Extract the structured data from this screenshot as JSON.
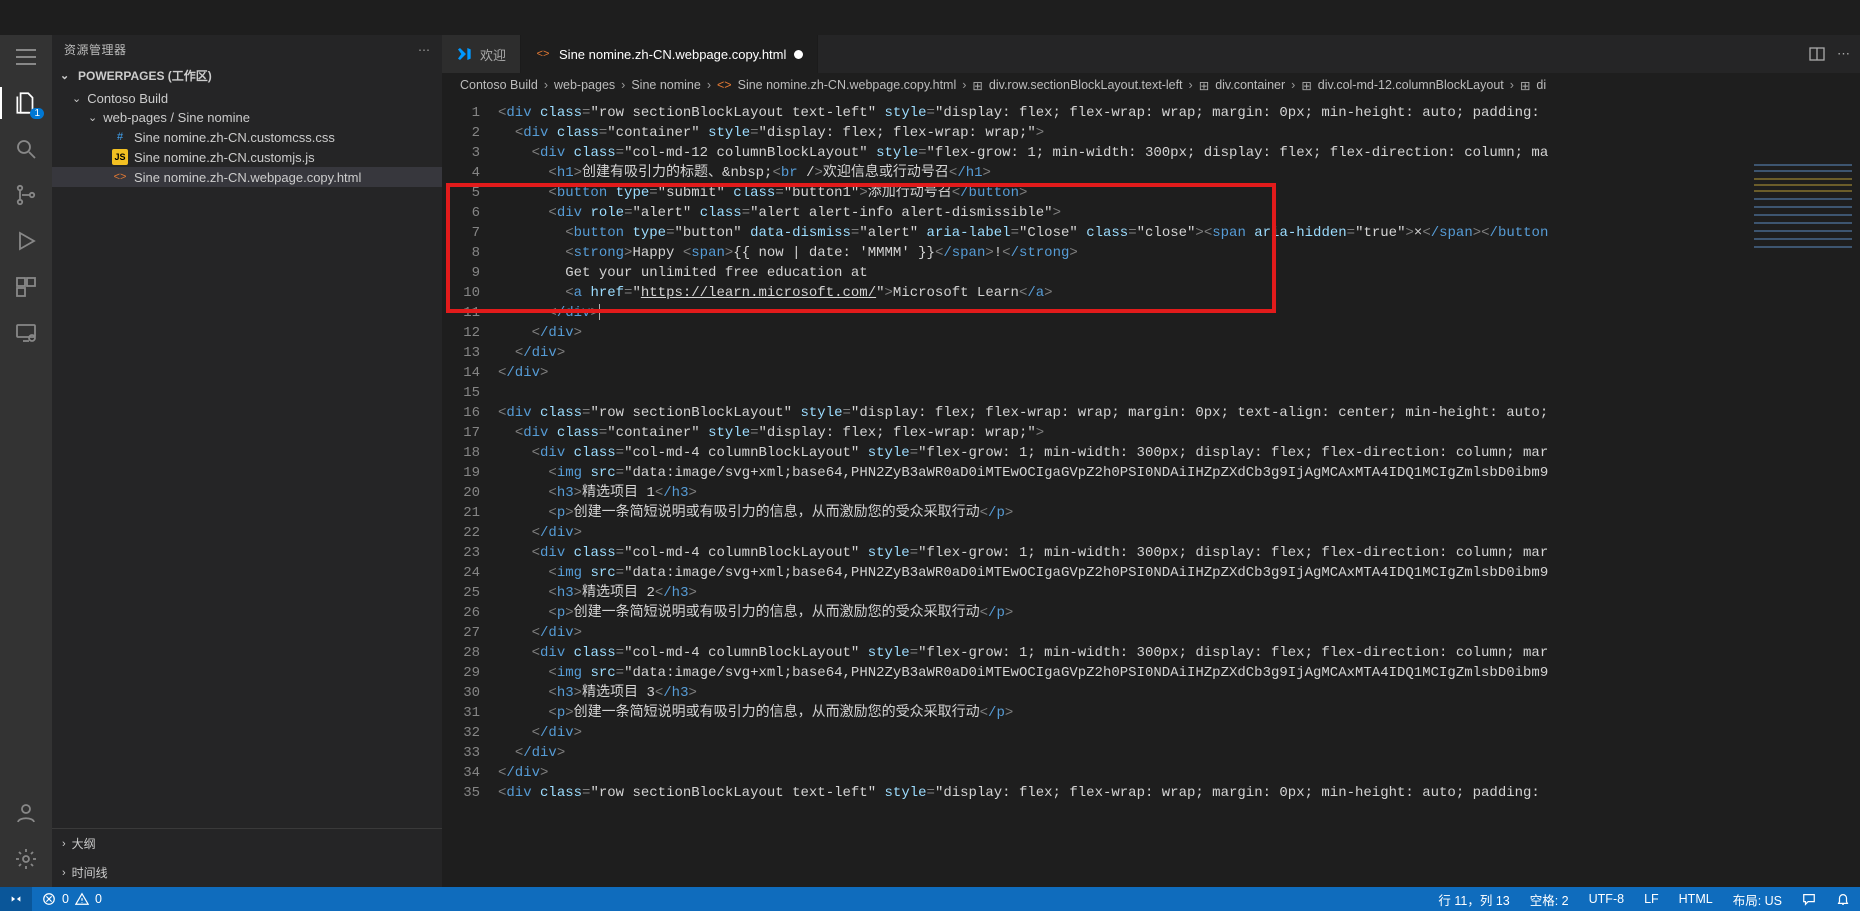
{
  "sidebar": {
    "header": "资源管理器",
    "section": "POWERPAGES (工作区)",
    "folders": {
      "root": "Contoso Build",
      "sub": "web-pages / Sine nomine"
    },
    "files": [
      {
        "icon": "css",
        "name": "Sine nomine.zh-CN.customcss.css"
      },
      {
        "icon": "js",
        "name": "Sine nomine.zh-CN.customjs.js"
      },
      {
        "icon": "html",
        "name": "Sine nomine.zh-CN.webpage.copy.html"
      }
    ],
    "outline": "大纲",
    "timeline": "时间线"
  },
  "tabs": {
    "first": "欢迎",
    "second": "Sine nomine.zh-CN.webpage.copy.html"
  },
  "breadcrumbs": {
    "a": "Contoso Build",
    "b": "web-pages",
    "c": "Sine nomine",
    "d": "Sine nomine.zh-CN.webpage.copy.html",
    "e": "div.row.sectionBlockLayout.text-left",
    "f": "div.container",
    "g": "div.col-md-12.columnBlockLayout",
    "h": "di"
  },
  "code": {
    "l1": "<div class=\"row sectionBlockLayout text-left\" style=\"display: flex; flex-wrap: wrap; margin: 0px; min-height: auto; padding: ",
    "l2": "  <div class=\"container\" style=\"display: flex; flex-wrap: wrap;\">",
    "l3": "    <div class=\"col-md-12 columnBlockLayout\" style=\"flex-grow: 1; min-width: 300px; display: flex; flex-direction: column; ma",
    "l4": "      <h1>创建有吸引力的标题、&nbsp;<br />欢迎信息或行动号召</h1>",
    "l5": "      <button type=\"submit\" class=\"button1\">添加行动号召</button>",
    "l6": "      <div role=\"alert\" class=\"alert alert-info alert-dismissible\">",
    "l7": "        <button type=\"button\" data-dismiss=\"alert\" aria-label=\"Close\" class=\"close\"><span aria-hidden=\"true\">×</span></button",
    "l8": "        <strong>Happy <span>{{ now | date: 'MMMM' }}</span>!</strong>",
    "l9": "        Get your unlimited free education at",
    "l10": "        <a href=\"https://learn.microsoft.com/\">Microsoft Learn</a>",
    "l11": "      </div>",
    "l12": "    </div>",
    "l13": "  </div>",
    "l14": "</div>",
    "l15": "",
    "l16": "<div class=\"row sectionBlockLayout\" style=\"display: flex; flex-wrap: wrap; margin: 0px; text-align: center; min-height: auto;",
    "l17": "  <div class=\"container\" style=\"display: flex; flex-wrap: wrap;\">",
    "l18": "    <div class=\"col-md-4 columnBlockLayout\" style=\"flex-grow: 1; min-width: 300px; display: flex; flex-direction: column; mar",
    "l19": "      <img src=\"data:image/svg+xml;base64,PHN2ZyB3aWR0aD0iMTEwOCIgaGVpZ2h0PSI0NDAiIHZpZXdCb3g9IjAgMCAxMTA4IDQ1MCIgZmlsbD0ibm9",
    "l20": "      <h3>精选项目 1</h3>",
    "l21": "      <p>创建一条简短说明或有吸引力的信息，从而激励您的受众采取行动</p>",
    "l22": "    </div>",
    "l23": "    <div class=\"col-md-4 columnBlockLayout\" style=\"flex-grow: 1; min-width: 300px; display: flex; flex-direction: column; mar",
    "l24": "      <img src=\"data:image/svg+xml;base64,PHN2ZyB3aWR0aD0iMTEwOCIgaGVpZ2h0PSI0NDAiIHZpZXdCb3g9IjAgMCAxMTA4IDQ1MCIgZmlsbD0ibm9",
    "l25": "      <h3>精选项目 2</h3>",
    "l26": "      <p>创建一条简短说明或有吸引力的信息，从而激励您的受众采取行动</p>",
    "l27": "    </div>",
    "l28": "    <div class=\"col-md-4 columnBlockLayout\" style=\"flex-grow: 1; min-width: 300px; display: flex; flex-direction: column; mar",
    "l29": "      <img src=\"data:image/svg+xml;base64,PHN2ZyB3aWR0aD0iMTEwOCIgaGVpZ2h0PSI0NDAiIHZpZXdCb3g9IjAgMCAxMTA4IDQ1MCIgZmlsbD0ibm9",
    "l30": "      <h3>精选项目 3</h3>",
    "l31": "      <p>创建一条简短说明或有吸引力的信息，从而激励您的受众采取行动</p>",
    "l32": "    </div>",
    "l33": "  </div>",
    "l34": "</div>",
    "l35": "<div class=\"row sectionBlockLayout text-left\" style=\"display: flex; flex-wrap: wrap; margin: 0px; min-height: auto; padding: "
  },
  "status": {
    "errors": "0",
    "warnings": "0",
    "lncol": "行 11，列 13",
    "spaces": "空格: 2",
    "enc": "UTF-8",
    "eol": "LF",
    "lang": "HTML",
    "layout": "布局: US"
  }
}
